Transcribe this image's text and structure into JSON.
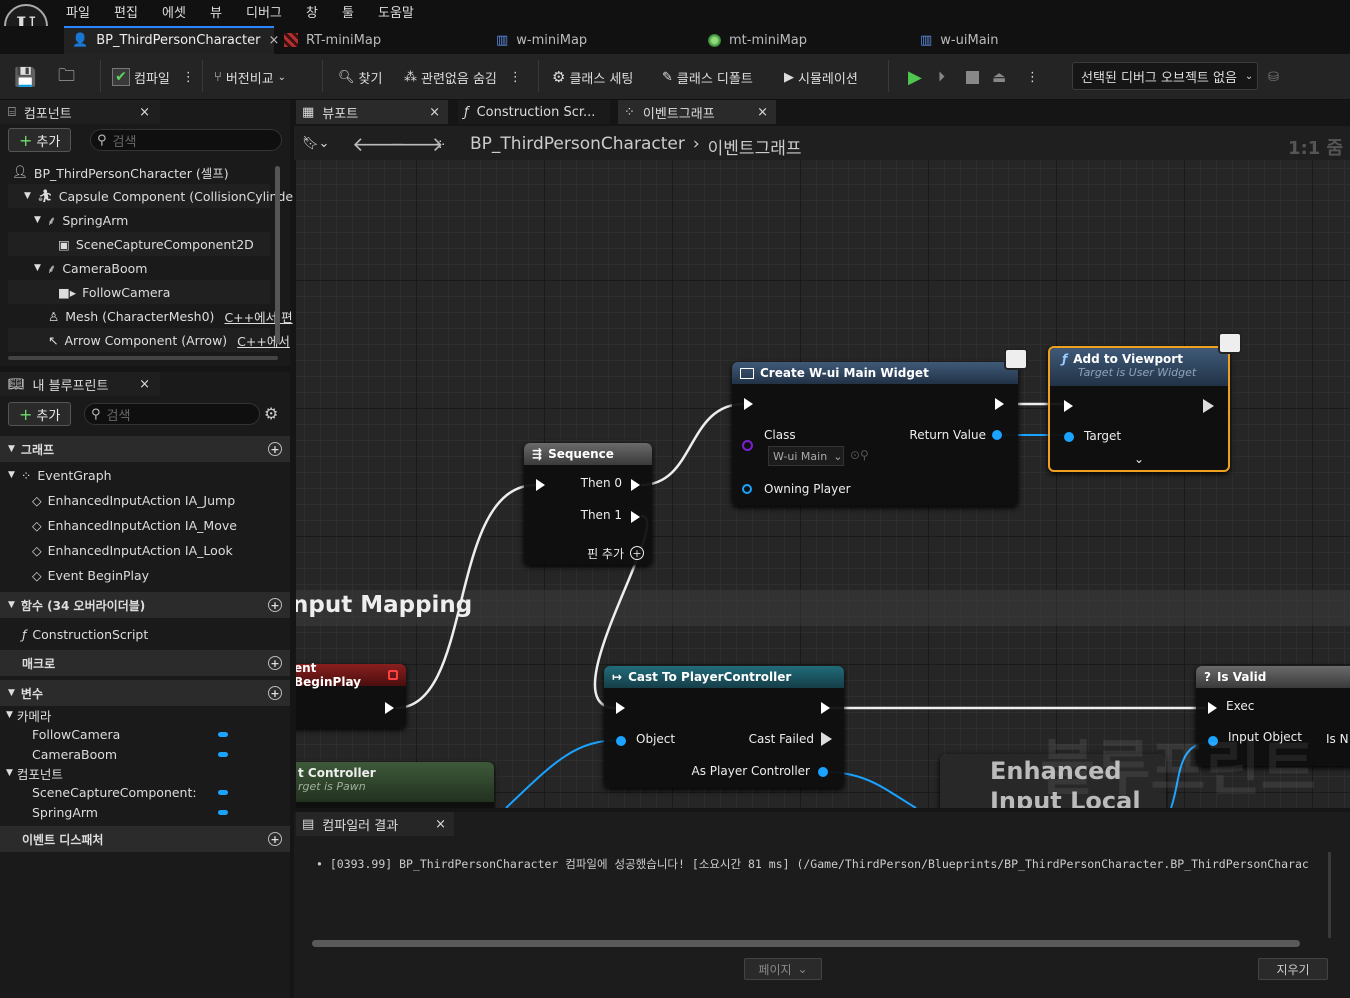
{
  "menu": [
    "파일",
    "편집",
    "에셋",
    "뷰",
    "디버그",
    "창",
    "툴",
    "도움말"
  ],
  "doc_tabs": [
    {
      "label": "BP_ThirdPersonCharacter",
      "active": true
    },
    {
      "label": "RT-miniMap"
    },
    {
      "label": "w-miniMap"
    },
    {
      "label": "mt-miniMap"
    },
    {
      "label": "w-uiMain"
    }
  ],
  "toolbar": {
    "compile": "컴파일",
    "source_control": "버전비교",
    "find": "찾기",
    "hide_unrelated": "관련없음 숨김",
    "class_settings": "클래스 세팅",
    "class_defaults": "클래스 디폴트",
    "simulation": "시뮬레이션",
    "debug_object": "선택된 디버그 오브젝트 없음"
  },
  "components": {
    "title": "컴포넌트",
    "add": "추가",
    "search_placeholder": "검색",
    "items": [
      {
        "label": "BP_ThirdPersonCharacter (셀프)",
        "indent": 0
      },
      {
        "label": "Capsule Component (CollisionCylinde",
        "indent": 1
      },
      {
        "label": "SpringArm",
        "indent": 2
      },
      {
        "label": "SceneCaptureComponent2D",
        "indent": 3
      },
      {
        "label": "CameraBoom",
        "indent": 2
      },
      {
        "label": "FollowCamera",
        "indent": 3
      },
      {
        "label": "Mesh (CharacterMesh0)",
        "suffix": "C++에서 편",
        "indent": 2
      },
      {
        "label": "Arrow Component (Arrow)",
        "suffix": "C++에서",
        "indent": 2
      }
    ]
  },
  "my_blueprint": {
    "title": "내 블루프린트",
    "add": "추가",
    "search_placeholder": "검색",
    "graphs_header": "그래프",
    "event_graph": "EventGraph",
    "events": [
      "EnhancedInputAction IA_Jump",
      "EnhancedInputAction IA_Move",
      "EnhancedInputAction IA_Look",
      "Event BeginPlay"
    ],
    "functions_header": "함수 (34 오버라이더블)",
    "construction_script": "ConstructionScript",
    "macros_header": "매크로",
    "variables_header": "변수",
    "var_groups": [
      {
        "name": "카메라",
        "vars": [
          "FollowCamera",
          "CameraBoom"
        ]
      },
      {
        "name": "컴포넌트",
        "vars": [
          "SceneCaptureComponent:",
          "SpringArm"
        ]
      }
    ],
    "dispatchers_header": "이벤트 디스패처"
  },
  "graph_tabs": [
    {
      "label": "뷰포트"
    },
    {
      "label": "Construction Scr..."
    },
    {
      "label": "이벤트그래프",
      "active": true
    }
  ],
  "breadcrumb": {
    "root": "BP_ThirdPersonCharacter",
    "current": "이벤트그래프",
    "zoom": "1:1 줌"
  },
  "nodes": {
    "sequence": {
      "title": "Sequence",
      "then0": "Then 0",
      "then1": "Then 1",
      "add_pin": "핀 추가"
    },
    "create_widget": {
      "title": "Create W-ui Main Widget",
      "class": "Class",
      "class_value": "W-ui Main",
      "return_value": "Return Value",
      "owning_player": "Owning Player"
    },
    "add_viewport": {
      "title": "Add to Viewport",
      "subtitle": "Target is User Widget",
      "target": "Target"
    },
    "input_mapping_comment": "nput Mapping",
    "begin_play": {
      "title": "ent BeginPlay"
    },
    "cast": {
      "title": "Cast To PlayerController",
      "object": "Object",
      "cast_failed": "Cast Failed",
      "as_pc": "As Player Controller"
    },
    "is_valid": {
      "title": "Is Valid",
      "exec": "Exec",
      "input_object": "Input Object",
      "is_not": "Is N"
    },
    "controller": {
      "title": "t Controller",
      "subtitle": "rget is Pawn"
    },
    "enhanced": {
      "line1": "Enhanced",
      "line2": "Input Local"
    },
    "watermark": "블루프린트"
  },
  "compiler": {
    "title": "컴파일러 결과",
    "message": "[0393.99] BP_ThirdPersonCharacter 컴파일에 성공했습니다! [소요시간 81 ms] (/Game/ThirdPerson/Blueprints/BP_ThirdPersonCharacter.BP_ThirdPersonCharac",
    "page": "페이지",
    "clear": "지우기"
  }
}
